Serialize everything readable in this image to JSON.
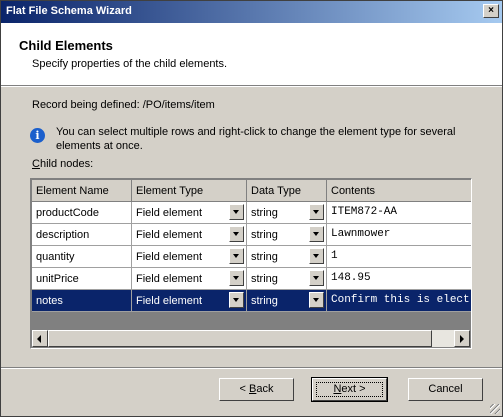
{
  "window": {
    "title": "Flat File Schema Wizard",
    "close_glyph": "×"
  },
  "header": {
    "title": "Child Elements",
    "subtitle": "Specify properties of the child elements."
  },
  "record": {
    "label": "Record being defined:",
    "path": "/PO/items/item"
  },
  "info": {
    "icon": "info-icon",
    "text": "You can select multiple rows and right-click to change the element type for several elements at once."
  },
  "child_nodes_label_prefix": "C",
  "child_nodes_label_rest": "hild nodes:",
  "grid": {
    "columns": [
      "Element Name",
      "Element Type",
      "Data Type",
      "Contents"
    ],
    "rows": [
      {
        "name": "productCode",
        "type": "Field element",
        "data_type": "string",
        "contents": "ITEM872-AA"
      },
      {
        "name": "description",
        "type": "Field element",
        "data_type": "string",
        "contents": "Lawnmower"
      },
      {
        "name": "quantity",
        "type": "Field element",
        "data_type": "string",
        "contents": "1"
      },
      {
        "name": "unitPrice",
        "type": "Field element",
        "data_type": "string",
        "contents": "148.95"
      },
      {
        "name": "notes",
        "type": "Field element",
        "data_type": "string",
        "contents": "Confirm this is elect",
        "selected": true
      }
    ]
  },
  "buttons": {
    "back": {
      "prefix": "< ",
      "mnemonic": "B",
      "rest": "ack"
    },
    "next": {
      "mnemonic": "N",
      "rest": "ext >"
    },
    "cancel": "Cancel"
  },
  "colors": {
    "selection": "#0a246a",
    "titlebar_start": "#0a246a",
    "titlebar_end": "#a6caf0",
    "face": "#d4d0c8"
  }
}
